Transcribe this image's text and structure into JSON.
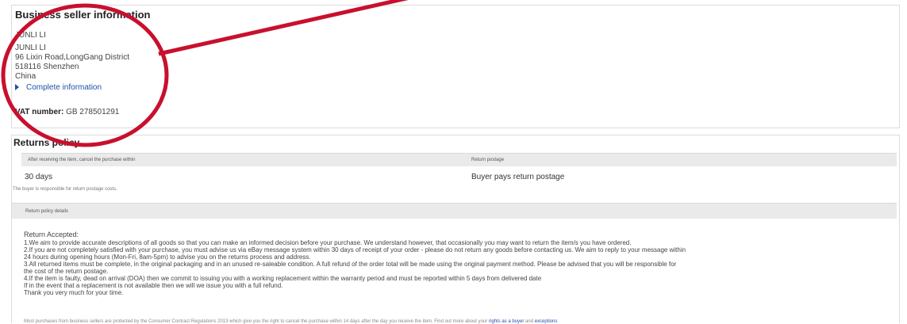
{
  "seller": {
    "title": "Business seller information",
    "name_line1": "JUNLI LI",
    "name_line2": "JUNLI LI",
    "address_line": "96 Lixin Road,LongGang District",
    "postcode_city": "518116 Shenzhen",
    "country": "China",
    "more_link": "Complete information",
    "vat_label": "VAT number:",
    "vat_value": "GB 278501291"
  },
  "returns": {
    "title": "Returns policy",
    "col1_header": "After receiving the item, cancel the purchase within",
    "col2_header": "Return postage",
    "col1_value": "30 days",
    "col2_value": "Buyer pays return postage",
    "note": "The buyer is responsible for return postage costs.",
    "details_header": "Return policy details",
    "details_lines": [
      "Return Accepted:",
      "1.We aim to provide accurate descriptions of all goods so that you can make an informed decision before your purchase. We understand however, that occasionally you may want to return the item/s you have ordered.",
      "2.If you are not completely satisfied with your purchase, you must advise us via eBay message system within 30 days of receipt of your order - please do not return any goods before contacting us. We aim to reply to your message within",
      "24 hours during opening hours (Mon-Fri, 8am-5pm) to advise you on the returns process and address.",
      "3.All returned items must be complete, in the original packaging and in an unused re-saleable condition. A full refund of the order total will be made using the original payment method. Please be advised that you will be responsible for",
      "the cost of the return postage.",
      "4.If the item is faulty, dead on arrival (DOA) then we commit to issuing you with a working replacement within the warranty period and must be reported within 5 days from delivered date",
      "If in the event that a replacement is not available then we will we issue you with a full refund.",
      "Thank you very much for your time."
    ],
    "footer_text": "Most purchases from business sellers are protected by the Consumer Contract Regulations 2013 which give you the right to cancel the purchase within 14 days after the day you receive the item. Find out more about your",
    "footer_link1": "rights as a buyer",
    "footer_and": "and",
    "footer_link2": "exceptions"
  },
  "annotation_color": "#c8102e",
  "link_color": "#1f4fa8"
}
